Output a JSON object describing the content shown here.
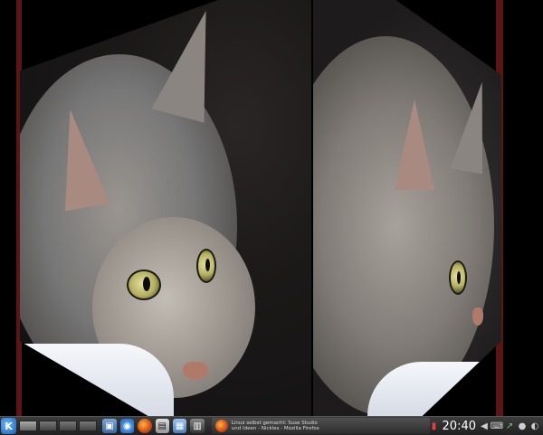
{
  "taskbar": {
    "kmenu_glyph": "K",
    "desktops": [
      "1",
      "2",
      "3",
      "4"
    ],
    "launchers": [
      {
        "name": "system-icon"
      },
      {
        "name": "network-icon"
      },
      {
        "name": "firefox-icon"
      },
      {
        "name": "terminal-icon"
      },
      {
        "name": "files-icon"
      },
      {
        "name": "film-icon"
      }
    ],
    "active_task": {
      "line1": "Linux selbst gemacht: Suse Studio",
      "line2": "und Ideen - Nickles - Mozilla Firefox"
    },
    "clock": "20:40",
    "tray_icons": [
      "battery-icon",
      "volume-icon",
      "keyboard-icon",
      "network-manager-icon",
      "info-icon",
      "power-icon"
    ]
  },
  "colors": {
    "panel_bg": "#2e2e2e",
    "accent": "#1a5fb4",
    "desktop_bg": "#000000"
  },
  "wallpaper": {
    "subject": "tabby cat close-up",
    "effect": "desktop cube"
  }
}
